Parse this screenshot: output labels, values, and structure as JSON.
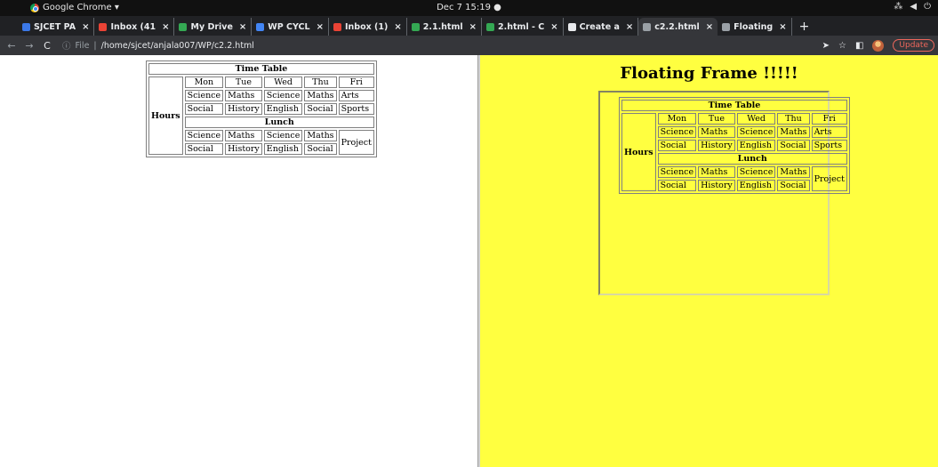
{
  "os": {
    "app_name": "Google Chrome ▾",
    "clock": "Dec 7  15:19  ●"
  },
  "tabs": [
    {
      "label": "SJCET PA",
      "icon_color": "#3b78e7",
      "icon": "sjcet-icon"
    },
    {
      "label": "Inbox (41",
      "icon_color": "#ea4335",
      "icon": "gmail-icon"
    },
    {
      "label": "My Drive",
      "icon_color": "#34a853",
      "icon": "drive-icon"
    },
    {
      "label": "WP CYCL",
      "icon_color": "#4285f4",
      "icon": "docs-icon"
    },
    {
      "label": "Inbox (1)",
      "icon_color": "#ea4335",
      "icon": "gmail-icon"
    },
    {
      "label": "2.1.html",
      "icon_color": "#34a853",
      "icon": "drive-icon"
    },
    {
      "label": "2.html - C",
      "icon_color": "#34a853",
      "icon": "drive-icon"
    },
    {
      "label": "Create a",
      "icon_color": "#e8eaed",
      "icon": "chrome-icon"
    },
    {
      "label": "c2.2.html",
      "icon_color": "#9aa0a6",
      "icon": "globe-icon",
      "active": true
    },
    {
      "label": "Floating",
      "icon_color": "#9aa0a6",
      "icon": "globe-icon"
    }
  ],
  "tab_close": "×",
  "new_tab": "+",
  "toolbar": {
    "info": "ⓘ",
    "scheme": "File",
    "sep": "|",
    "path": "/home/sjcet/anjala007/WP/c2.2.html",
    "update_label": "Update"
  },
  "timetable": {
    "title": "Time Table",
    "row_header": "Hours",
    "days": [
      "Mon",
      "Tue",
      "Wed",
      "Thu",
      "Fri"
    ],
    "morning": [
      [
        "Science",
        "Maths",
        "Science",
        "Maths",
        "Arts"
      ],
      [
        "Social",
        "History",
        "English",
        "Social",
        "Sports"
      ]
    ],
    "lunch": "Lunch",
    "afternoon": [
      [
        "Science",
        "Maths",
        "Science",
        "Maths"
      ],
      [
        "Social",
        "History",
        "English",
        "Social"
      ]
    ],
    "project": "Project"
  },
  "right": {
    "heading": "Floating Frame !!!!!",
    "background": "#ffff40"
  }
}
